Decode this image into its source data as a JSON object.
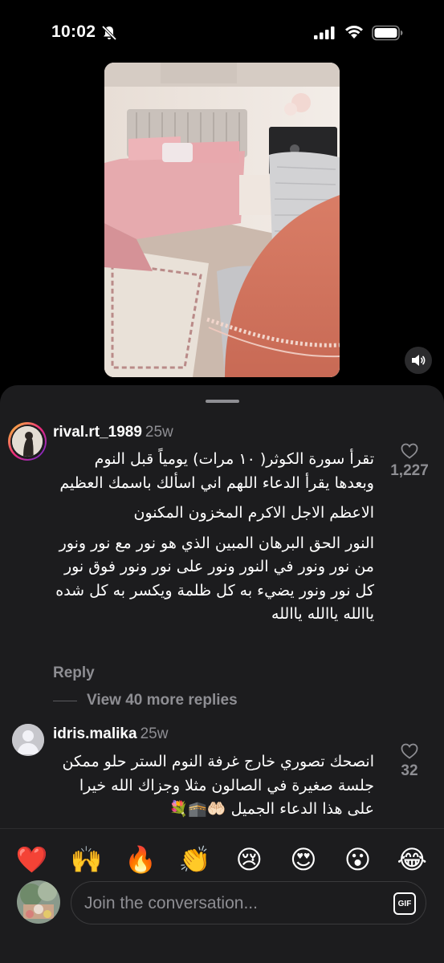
{
  "status_bar": {
    "time": "10:02",
    "icons": [
      "bell-off-icon",
      "signal-icon",
      "wifi-icon",
      "battery-icon"
    ]
  },
  "video": {
    "mute_icon": "speaker-icon"
  },
  "comments": [
    {
      "username": "rival.rt_1989",
      "timestamp": "25w",
      "paragraphs": [
        "تقرأ سورة الكوثر( ١٠ مرات) يومياً قبل النوم وبعدها يقرأ الدعاء اللهم اني اسألك باسمك العظيم",
        "الاعظم الاجل الاكرم المخزون المكنون",
        "النور الحق البرهان المبين الذي هو نور مع نور ونور من نور ونور في النور ونور على نور ونور فوق نور كل نور ونور يضيء به كل ظلمة ويكسر به كل شده ياالله ياالله ياالله"
      ],
      "likes": "1,227",
      "reply_label": "Reply",
      "view_replies_label": "View 40 more replies"
    },
    {
      "username": "idris.malika",
      "timestamp": "25w",
      "paragraphs": [
        "انصحك تصوري خارج غرفة النوم الستر حلو ممكن جلسة صغيرة في الصالون مثلا وجزاك الله خيرا على هذا الدعاء الجميل 🤲🏻🕋💐"
      ],
      "likes": "32"
    }
  ],
  "emoji_bar": [
    "❤️",
    "🙌",
    "🔥",
    "👏",
    "😢",
    "😍",
    "😮",
    "😂"
  ],
  "composer": {
    "placeholder": "Join the conversation...",
    "gif_label": "GIF"
  },
  "colors": {
    "sheet_bg": "#1c1c1e",
    "secondary_text": "#8e8e93",
    "story_ring_start": "#f9ce34",
    "story_ring_end": "#c13584"
  }
}
